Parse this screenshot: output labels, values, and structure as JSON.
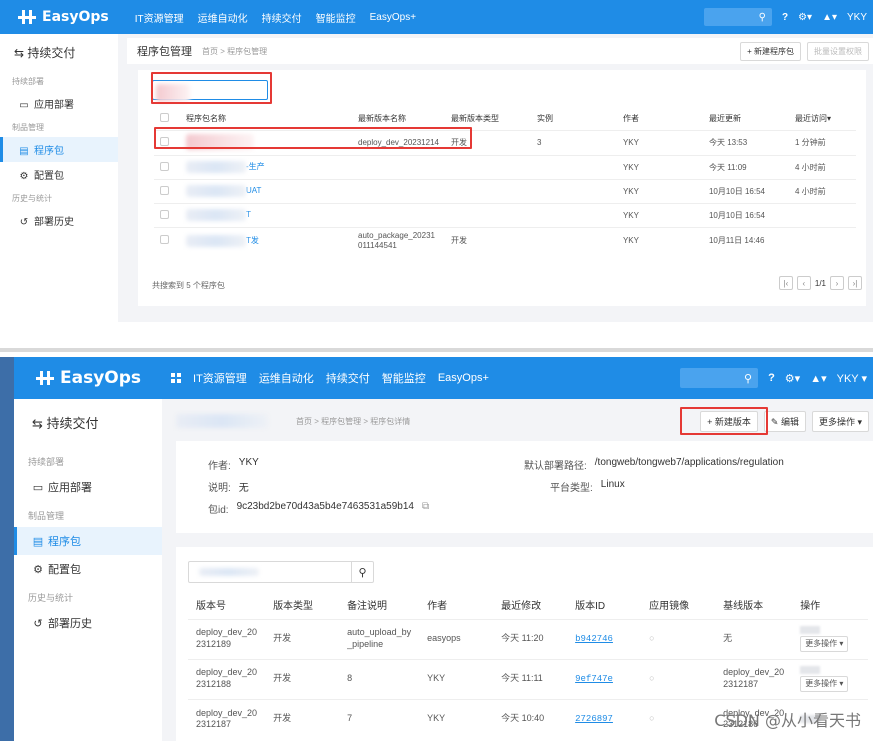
{
  "app": {
    "logo": "EasyOps",
    "nav": [
      "IT资源管理",
      "运维自动化",
      "持续交付",
      "智能监控",
      "EasyOps+"
    ],
    "user": "YKY"
  },
  "top": {
    "sidebar": {
      "title": "持续交付",
      "groups": [
        {
          "label": "持续部署",
          "items": [
            {
              "label": "应用部署",
              "icon": "monitor-icon"
            }
          ]
        },
        {
          "label": "制品管理",
          "items": [
            {
              "label": "程序包",
              "icon": "package-icon",
              "active": true
            },
            {
              "label": "配置包",
              "icon": "config-icon"
            }
          ]
        },
        {
          "label": "历史与统计",
          "items": [
            {
              "label": "部署历史",
              "icon": "history-icon"
            }
          ]
        }
      ]
    },
    "header": {
      "title": "程序包管理",
      "breadcrumb": "首页 > 程序包管理",
      "new_button": "+ 新建程序包",
      "batch_button": "批量设置权限"
    },
    "table": {
      "columns": [
        "程序包名称",
        "最新版本名称",
        "最新版本类型",
        "实例",
        "作者",
        "最近更新",
        "最近访问"
      ],
      "rows": [
        {
          "name": "",
          "version": "deploy_dev_20231214",
          "type": "开发",
          "instances": "3",
          "author": "YKY",
          "updated": "今天 13:53",
          "visited": "1 分钟前"
        },
        {
          "name": "-生产",
          "version": "",
          "type": "",
          "instances": "",
          "author": "YKY",
          "updated": "今天 11:09",
          "visited": "4 小时前"
        },
        {
          "name": "UAT",
          "version": "",
          "type": "",
          "instances": "",
          "author": "YKY",
          "updated": "10月10日 16:54",
          "visited": "4 小时前"
        },
        {
          "name": "T",
          "version": "",
          "type": "",
          "instances": "",
          "author": "YKY",
          "updated": "10月10日 16:54",
          "visited": ""
        },
        {
          "name": "T发",
          "version": "auto_package_20231011144541",
          "type": "开发",
          "instances": "",
          "author": "YKY",
          "updated": "10月11日 14:46",
          "visited": ""
        }
      ],
      "summary": "共搜索到 5 个程序包",
      "page": "1/1"
    }
  },
  "bottom": {
    "sidebar": {
      "title": "持续交付",
      "groups": [
        {
          "label": "持续部署",
          "items": [
            {
              "label": "应用部署",
              "icon": "monitor-icon"
            }
          ]
        },
        {
          "label": "制品管理",
          "items": [
            {
              "label": "程序包",
              "icon": "package-icon",
              "active": true
            },
            {
              "label": "配置包",
              "icon": "config-icon"
            }
          ]
        },
        {
          "label": "历史与统计",
          "items": [
            {
              "label": "部署历史",
              "icon": "history-icon"
            }
          ]
        }
      ]
    },
    "header": {
      "breadcrumb": "首页 > 程序包管理 > 程序包详情",
      "new_version_button": "+ 新建版本",
      "edit_button": "编辑",
      "more_button": "更多操作"
    },
    "info": {
      "author_label": "作者:",
      "author": "YKY",
      "desc_label": "说明:",
      "desc": "无",
      "id_label": "包id:",
      "id": "9c23bd2be70d43a5b4e7463531a59b14",
      "path_label": "默认部署路径:",
      "path": "/tongweb/tongweb7/applications/regulation",
      "platform_label": "平台类型:",
      "platform": "Linux"
    },
    "versions": {
      "search_placeholder": "",
      "columns": [
        "版本号",
        "版本类型",
        "备注说明",
        "作者",
        "最近修改",
        "版本ID",
        "应用镜像",
        "基线版本",
        "操作"
      ],
      "rows": [
        {
          "version": "deploy_dev_20\n2312189",
          "type": "开发",
          "note": "auto_upload_by\n_pipeline",
          "author": "easyops",
          "modified": "今天 11:20",
          "vid": "b942746",
          "baseline": "无",
          "more": "更多操作"
        },
        {
          "version": "deploy_dev_20\n2312188",
          "type": "开发",
          "note": "8",
          "author": "YKY",
          "modified": "今天 11:11",
          "vid": "9ef747e",
          "baseline": "deploy_dev_20\n2312187",
          "more": "更多操作"
        },
        {
          "version": "deploy_dev_20\n2312187",
          "type": "开发",
          "note": "7",
          "author": "YKY",
          "modified": "今天 10:40",
          "vid": "2726897",
          "baseline": "deploy_dev_20\n2312186",
          "more": ""
        }
      ]
    },
    "watermark": "CSDN @从小看天书"
  }
}
